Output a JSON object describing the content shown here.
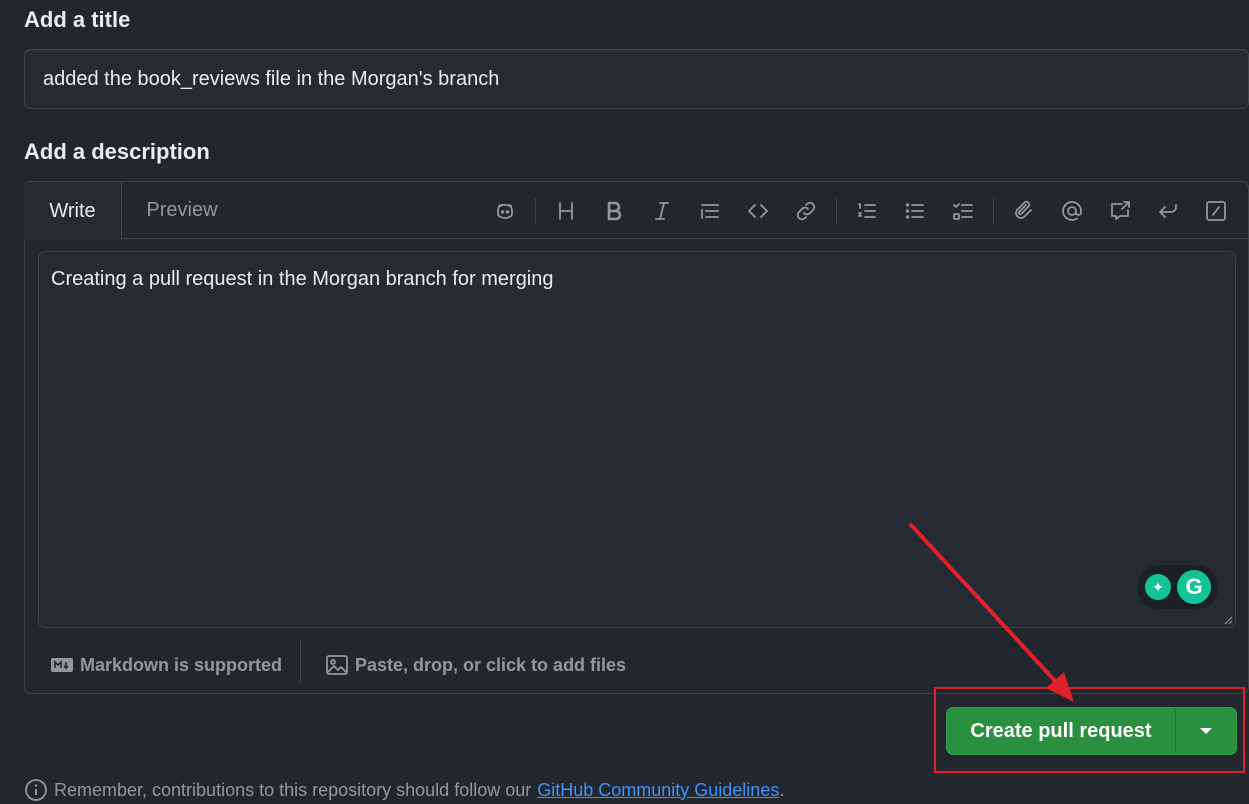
{
  "title_section": {
    "label": "Add a title",
    "value": "added the book_reviews file in the Morgan's branch"
  },
  "description_section": {
    "label": "Add a description",
    "tabs": [
      {
        "label": "Write",
        "active": true
      },
      {
        "label": "Preview",
        "active": false
      }
    ],
    "toolbar_icons": [
      "copilot-icon",
      "heading-icon",
      "bold-icon",
      "italic-icon",
      "quote-icon",
      "code-icon",
      "link-icon",
      "ordered-list-icon",
      "unordered-list-icon",
      "task-list-icon",
      "attach-icon",
      "mention-icon",
      "reference-icon",
      "reply-icon",
      "slash-commands-icon"
    ],
    "body": "Creating a pull request in the Morgan branch for merging",
    "footer": {
      "markdown_label": "Markdown is supported",
      "files_label": "Paste, drop, or click to add files"
    }
  },
  "grammarly": {
    "logo_letter": "G"
  },
  "actions": {
    "create_label": "Create pull request"
  },
  "notice": {
    "prefix": "Remember, contributions to this repository should follow our",
    "link": "GitHub Community Guidelines",
    "suffix": "."
  },
  "annotation": {
    "highlight_color": "#e0202a"
  },
  "colors": {
    "background": "#22262f",
    "accent_green": "#2a8f3e",
    "link_blue": "#4493f8"
  }
}
